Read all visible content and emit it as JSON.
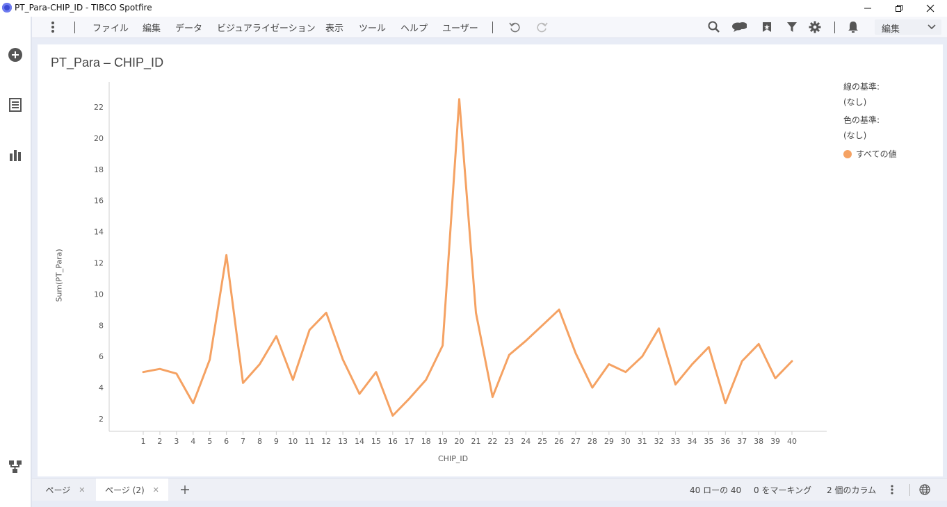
{
  "window": {
    "title": "PT_Para-CHIP_ID - TIBCO Spotfire"
  },
  "menu": {
    "items": [
      "ファイル",
      "編集",
      "データ",
      "ビジュアライゼーション",
      "表示",
      "ツール",
      "ヘルプ",
      "ユーザー"
    ],
    "mode": "編集"
  },
  "viz": {
    "title": "PT_Para – CHIP_ID",
    "legend": {
      "line_by_label": "線の基準:",
      "line_by_value": "(なし)",
      "color_by_label": "色の基準:",
      "color_by_value": "(なし)",
      "series_label": "すべての値"
    }
  },
  "chart_data": {
    "type": "line",
    "title": "PT_Para – CHIP_ID",
    "xlabel": "CHIP_ID",
    "ylabel": "Sum(PT_Para)",
    "x": [
      1,
      2,
      3,
      4,
      5,
      6,
      7,
      8,
      9,
      10,
      11,
      12,
      13,
      14,
      15,
      16,
      17,
      18,
      19,
      20,
      21,
      22,
      23,
      24,
      25,
      26,
      27,
      28,
      29,
      30,
      31,
      32,
      33,
      34,
      35,
      36,
      37,
      38,
      39,
      40
    ],
    "series": [
      {
        "values": [
          5.0,
          5.2,
          4.9,
          3.0,
          5.8,
          12.5,
          4.3,
          5.5,
          7.3,
          4.5,
          7.7,
          8.8,
          5.8,
          3.6,
          5.0,
          2.2,
          3.3,
          4.5,
          6.7,
          22.5,
          8.8,
          3.4,
          6.1,
          7.0,
          8.0,
          9.0,
          6.2,
          4.0,
          5.5,
          5.0,
          6.0,
          7.8,
          4.2,
          5.5,
          6.6,
          3.0,
          5.7,
          6.8,
          4.6,
          5.7
        ]
      }
    ],
    "yticks": [
      2,
      4,
      6,
      8,
      10,
      12,
      14,
      16,
      18,
      20,
      22
    ],
    "ylim": [
      1.2,
      23.6
    ],
    "grid": false,
    "legend_position": "right",
    "line_color": "#f5a263"
  },
  "bottom": {
    "tabs": [
      "ページ",
      "ページ (2)"
    ],
    "status_rows": "40 ローの 40",
    "status_marked": "0 をマーキング",
    "status_columns": "2 個のカラム"
  }
}
